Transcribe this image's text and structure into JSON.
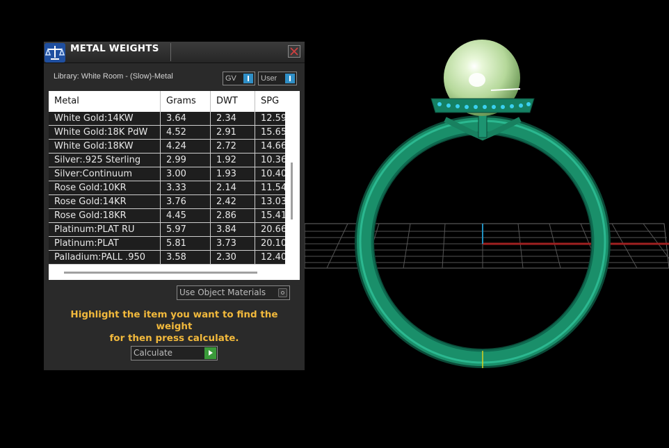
{
  "panel": {
    "title": "METAL WEIGHTS",
    "library_label": "Library: White Room - (Slow)-Metal",
    "gv_select": "GV",
    "user_select": "User",
    "columns": [
      "Metal",
      "Grams",
      "DWT",
      "SPG"
    ],
    "rows": [
      {
        "metal": "White Gold:14KW",
        "grams": "3.64",
        "dwt": "2.34",
        "spg": "12.59"
      },
      {
        "metal": "White Gold:18K PdW",
        "grams": "4.52",
        "dwt": "2.91",
        "spg": "15.65"
      },
      {
        "metal": "White Gold:18KW",
        "grams": "4.24",
        "dwt": "2.72",
        "spg": "14.66"
      },
      {
        "metal": "Silver:.925 Sterling",
        "grams": "2.99",
        "dwt": "1.92",
        "spg": "10.36"
      },
      {
        "metal": "Silver:Continuum",
        "grams": "3.00",
        "dwt": "1.93",
        "spg": "10.40"
      },
      {
        "metal": "Rose Gold:10KR",
        "grams": "3.33",
        "dwt": "2.14",
        "spg": "11.54"
      },
      {
        "metal": "Rose Gold:14KR",
        "grams": "3.76",
        "dwt": "2.42",
        "spg": "13.03"
      },
      {
        "metal": "Rose Gold:18KR",
        "grams": "4.45",
        "dwt": "2.86",
        "spg": "15.41"
      },
      {
        "metal": "Platinum:PLAT RU",
        "grams": "5.97",
        "dwt": "3.84",
        "spg": "20.66"
      },
      {
        "metal": "Platinum:PLAT",
        "grams": "5.81",
        "dwt": "3.73",
        "spg": "20.10"
      },
      {
        "metal": "Palladium:PALL .950",
        "grams": "3.58",
        "dwt": "2.30",
        "spg": "12.40"
      }
    ],
    "use_object_materials": "Use Object Materials",
    "hint_line1": "Highlight the item you want to find the weight",
    "hint_line2": "for then press calculate.",
    "calculate_label": "Calculate"
  },
  "colors": {
    "hint_text": "#f2b93c",
    "ring_green": "#1a8f6a",
    "axis_red": "#a02020",
    "axis_blue": "#2090c0"
  },
  "icons": {
    "title": "scale-icon",
    "close": "close-icon"
  }
}
